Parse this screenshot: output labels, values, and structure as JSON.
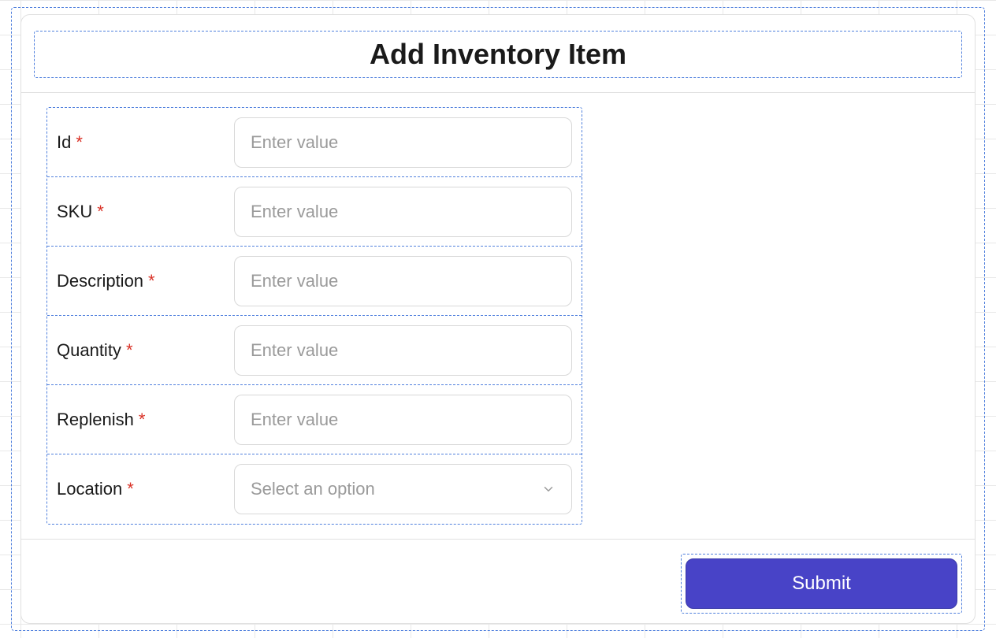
{
  "form": {
    "title": "Add Inventory Item",
    "submit_label": "Submit",
    "fields": [
      {
        "label": "Id",
        "required": true,
        "placeholder": "Enter value",
        "type": "text"
      },
      {
        "label": "SKU",
        "required": true,
        "placeholder": "Enter value",
        "type": "text"
      },
      {
        "label": "Description",
        "required": true,
        "placeholder": "Enter value",
        "type": "text"
      },
      {
        "label": "Quantity",
        "required": true,
        "placeholder": "Enter value",
        "type": "text"
      },
      {
        "label": "Replenish",
        "required": true,
        "placeholder": "Enter value",
        "type": "text"
      },
      {
        "label": "Location",
        "required": true,
        "placeholder": "Select an option",
        "type": "select"
      }
    ]
  },
  "required_marker": "*"
}
